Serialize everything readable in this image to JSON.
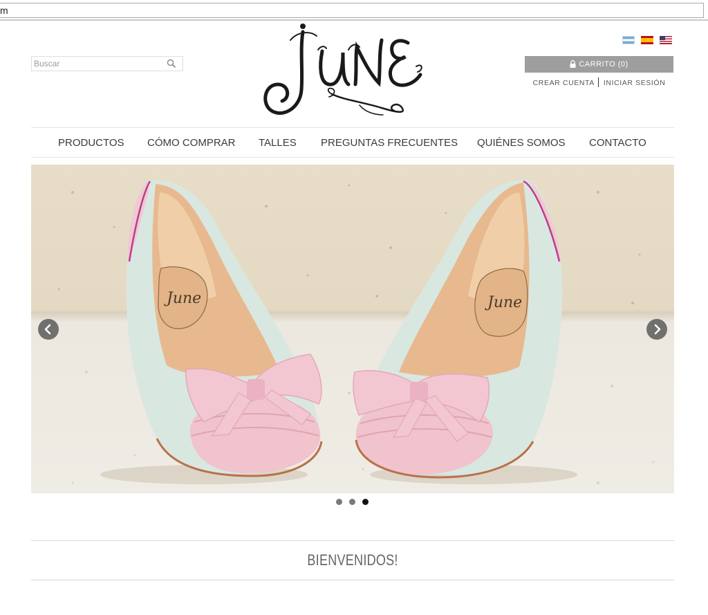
{
  "browser": {
    "address_fragment": "m"
  },
  "search": {
    "placeholder": "Buscar",
    "icon": "search-icon"
  },
  "logo": {
    "text": "June"
  },
  "languages": [
    {
      "code": "ar",
      "icon": "argentina-flag-icon"
    },
    {
      "code": "es",
      "icon": "spain-flag-icon"
    },
    {
      "code": "us",
      "icon": "usa-flag-icon"
    }
  ],
  "cart": {
    "label": "CARRITO (0)",
    "icon": "lock-icon"
  },
  "account": {
    "create": "CREAR CUENTA",
    "login": "INICIAR SESIÓN"
  },
  "nav": {
    "items": [
      {
        "label": "PRODUCTOS"
      },
      {
        "label": "CÓMO COMPRAR"
      },
      {
        "label": "TALLES"
      },
      {
        "label": "PREGUNTAS FRECUENTES"
      },
      {
        "label": "QUIÉNES SOMOS"
      },
      {
        "label": "CONTACTO"
      }
    ]
  },
  "slider": {
    "prev_icon": "chevron-left-icon",
    "next_icon": "chevron-right-icon",
    "slide_count": 3,
    "active_slide": 3,
    "insole_brand": "June"
  },
  "welcome": {
    "title": "BIENVENIDOS!"
  },
  "colors": {
    "cart_bg": "#9e9e9e",
    "shoe_mint": "#d9e7e1",
    "shoe_pink": "#f0c3cd",
    "insole_tan": "#e8b98e",
    "text_dark": "#333333"
  }
}
